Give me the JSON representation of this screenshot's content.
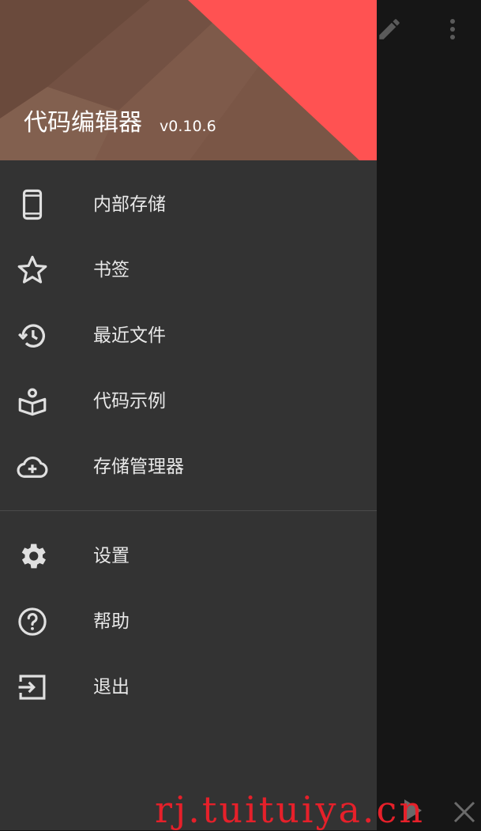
{
  "drawer": {
    "title": "代码编辑器",
    "version": "v0.10.6",
    "items": [
      {
        "id": "internal-storage",
        "label": "内部存储",
        "icon": "phone-icon"
      },
      {
        "id": "bookmarks",
        "label": "书签",
        "icon": "star-icon"
      },
      {
        "id": "recent-files",
        "label": "最近文件",
        "icon": "history-icon"
      },
      {
        "id": "code-examples",
        "label": "代码示例",
        "icon": "book-person-icon"
      },
      {
        "id": "storage-manager",
        "label": "存储管理器",
        "icon": "cloud-add-icon"
      }
    ],
    "secondary_items": [
      {
        "id": "settings",
        "label": "设置",
        "icon": "gear-icon"
      },
      {
        "id": "help",
        "label": "帮助",
        "icon": "help-circle-icon"
      },
      {
        "id": "exit",
        "label": "退出",
        "icon": "exit-icon"
      }
    ]
  },
  "watermark": "rj.tuituiya.cn",
  "colors": {
    "header_red": "#ff5252",
    "header_brown": "#7a5646",
    "drawer_bg": "#333333",
    "main_bg": "#161616"
  }
}
